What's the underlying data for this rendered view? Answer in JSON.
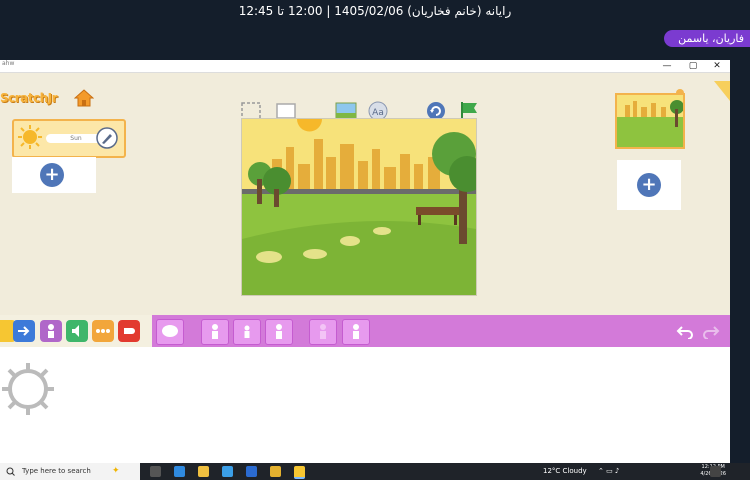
{
  "session": {
    "title": "رایانه (خانم فخاریان) 1405/02/06 | 12:00 تا 12:45"
  },
  "user": {
    "name": "فاریان، یاسمن"
  },
  "window": {
    "title": "ahw",
    "min": "—",
    "max": "▢",
    "close": "✕"
  },
  "app": {
    "logo": "ScratchJr",
    "sprite_name": "Sun",
    "add_sprite": "+",
    "add_page": "+"
  },
  "taskbar": {
    "search_placeholder": "Type here to search",
    "weather": "12°C Cloudy",
    "time": "12:12 PM",
    "date": "4/26/2026"
  }
}
